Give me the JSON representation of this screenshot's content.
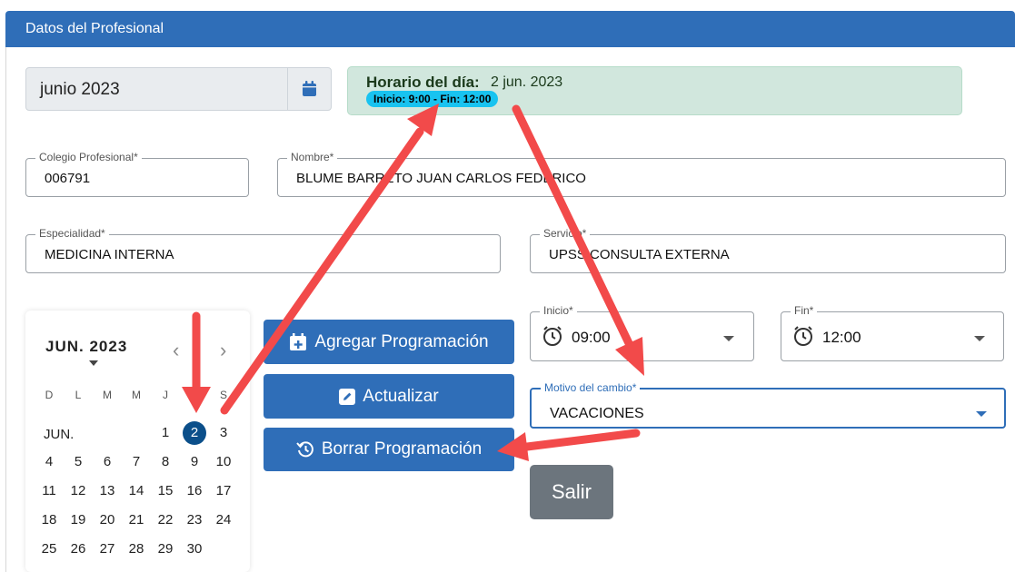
{
  "header": {
    "title": "Datos del Profesional"
  },
  "month_picker": {
    "value": "junio  2023",
    "icon": "calendar-icon"
  },
  "schedule": {
    "label": "Horario del día:",
    "date": "2 jun. 2023",
    "hours": "Inicio: 9:00 - Fin: 12:00"
  },
  "form": {
    "colegio": {
      "label": "Colegio Profesional*",
      "value": "006791"
    },
    "nombre": {
      "label": "Nombre*",
      "value": "BLUME BARRETO JUAN CARLOS FEDERICO"
    },
    "especialidad": {
      "label": "Especialidad*",
      "value": "MEDICINA INTERNA"
    },
    "servicio": {
      "label": "Servicio*",
      "value": "UPSS CONSULTA EXTERNA"
    },
    "inicio": {
      "label": "Inicio*",
      "value": "09:00"
    },
    "fin": {
      "label": "Fin*",
      "value": "12:00"
    },
    "motivo": {
      "label": "Motivo del cambio*",
      "value": "VACACIONES"
    }
  },
  "calendar": {
    "title": "JUN. 2023",
    "month_label": "JUN.",
    "prev": "‹",
    "next": "›",
    "weekdays": [
      "D",
      "L",
      "M",
      "M",
      "J",
      "V",
      "S"
    ],
    "selected_day": "2",
    "weeks": [
      [
        "",
        "",
        "",
        "",
        "1",
        "2",
        "3"
      ],
      [
        "4",
        "5",
        "6",
        "7",
        "8",
        "9",
        "10"
      ],
      [
        "11",
        "12",
        "13",
        "14",
        "15",
        "16",
        "17"
      ],
      [
        "18",
        "19",
        "20",
        "21",
        "22",
        "23",
        "24"
      ],
      [
        "25",
        "26",
        "27",
        "28",
        "29",
        "30",
        ""
      ]
    ]
  },
  "buttons": {
    "agregar": "Agregar Programación",
    "actualizar": "Actualizar",
    "borrar": "Borrar Programación",
    "salir": "Salir"
  },
  "colors": {
    "primary": "#2f6eb8",
    "schedule_bg": "#d1e7dd",
    "pill": "#18c3f0",
    "selected_day": "#0b4f8a",
    "exit": "#6c757d",
    "annotation": "#f24a4a"
  }
}
